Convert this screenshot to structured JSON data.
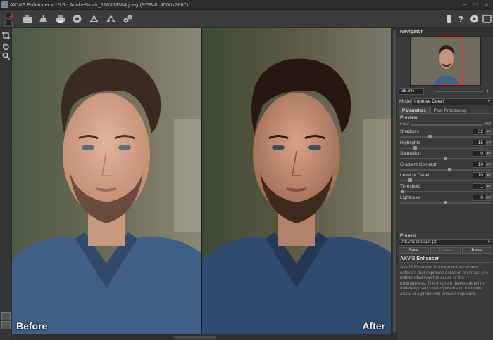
{
  "window": {
    "title": "AKVIS Enhancer v.16.5 - AdobeStock_116358384.jpeg (RGB/8, 4000x2667)",
    "controls": [
      "–",
      "□",
      "×"
    ]
  },
  "toolbar": {
    "left_icons": [
      "open-icon",
      "save-icon",
      "print-icon",
      "share-icon",
      "batch-icon",
      "plugin-icon",
      "settings-gears-icon"
    ],
    "right_icons": [
      "run-icon",
      "help-icon",
      "preferences-icon",
      "toggle-view-icon"
    ]
  },
  "left_tools": [
    "crop-icon",
    "hand-icon",
    "zoom-icon"
  ],
  "canvas": {
    "before_label": "Before",
    "after_label": "After"
  },
  "navigator": {
    "title": "Navigator",
    "zoom": "36.8%"
  },
  "mode": {
    "label": "Mode:",
    "value": "Improve Detail"
  },
  "tabs": [
    {
      "label": "Parameters",
      "active": true
    },
    {
      "label": "Post Processing",
      "active": false
    }
  ],
  "preview": {
    "label": "Preview",
    "fast": "Fast",
    "hq": "HQ"
  },
  "parameters": [
    {
      "label": "Shadows",
      "value": "32",
      "level": 0.32
    },
    {
      "label": "Highlights",
      "value": "15",
      "level": 0.15
    },
    {
      "label": "Saturation",
      "value": "0",
      "level": 0.5
    },
    {
      "label": "Gradient Contrast",
      "value": "10",
      "level": 0.55
    },
    {
      "label": "Level of Detail",
      "value": "10",
      "level": 0.1
    },
    {
      "label": "Threshold",
      "value": "1",
      "level": 0.01
    },
    {
      "label": "Lightness",
      "value": "0",
      "level": 0.5
    }
  ],
  "presets": {
    "label": "Presets",
    "value": "AKVIS Default (2)",
    "save": "Save",
    "delete": "Delete",
    "reset": "Reset"
  },
  "description": {
    "title": "AKVIS Enhancer",
    "text": "AKVIS Enhancer is image enhancement software that improves detail on an image, no matter what was the cause of the unsharpness. The program detects detail in underexposed, overexposed and mid tone areas of a photo with uneven exposure."
  },
  "colors": {
    "background": "#3a3a3a",
    "panel": "#3a3a3a",
    "shirt_blue": "#3f5f86",
    "nav_frame": "#ee3333"
  }
}
